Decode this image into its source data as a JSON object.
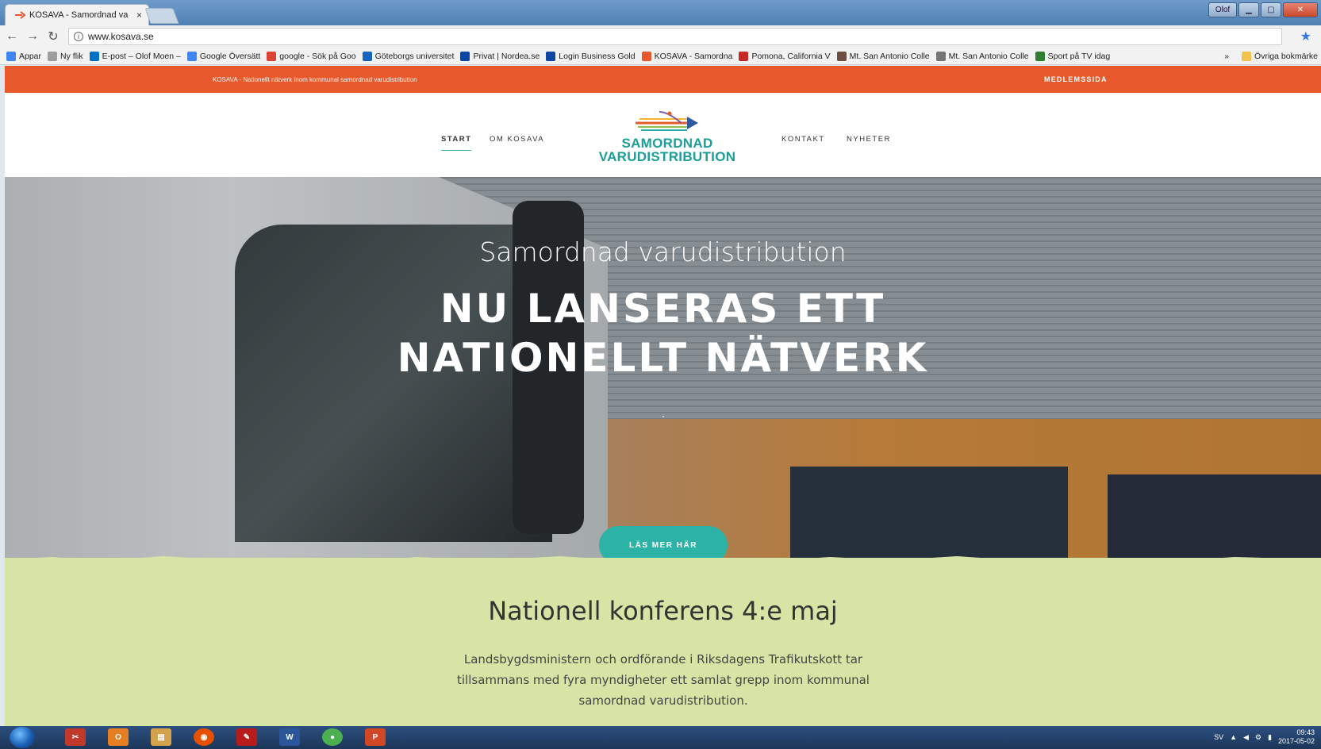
{
  "browser": {
    "tab_title": "KOSAVA - Samordnad va",
    "tab_close": "×",
    "url": "www.kosava.se",
    "window_user": "Olof",
    "bookmarks": [
      {
        "label": "Appar",
        "color": "#4285f4"
      },
      {
        "label": "Ny flik",
        "color": "#9e9e9e"
      },
      {
        "label": "E-post – Olof Moen –",
        "color": "#0072c6"
      },
      {
        "label": "Google Översätt",
        "color": "#4285f4"
      },
      {
        "label": "google - Sök på Goo",
        "color": "#db4437"
      },
      {
        "label": "Göteborgs universitet",
        "color": "#1565c0"
      },
      {
        "label": "Privat | Nordea.se",
        "color": "#0d47a1"
      },
      {
        "label": "Login Business Gold",
        "color": "#0d47a1"
      },
      {
        "label": "KOSAVA - Samordna",
        "color": "#e7582a"
      },
      {
        "label": "Pomona, California V",
        "color": "#c62828"
      },
      {
        "label": "Mt. San Antonio Colle",
        "color": "#6d4c41"
      },
      {
        "label": "Mt. San Antonio Colle",
        "color": "#757575"
      },
      {
        "label": "Sport på TV idag",
        "color": "#2e7d32"
      }
    ],
    "more": "»",
    "other_bookmarks": "Övriga bokmärke"
  },
  "site": {
    "topbar": {
      "tagline": "KOSAVA - Nationellt nätverk inom kommunal samordnad varudistribution",
      "member_link": "MEDLEMSSIDA"
    },
    "nav": {
      "start": "START",
      "om": "OM KOSAVA",
      "kontakt": "KONTAKT",
      "nyheter": "NYHETER"
    },
    "logo": {
      "line1": "SAMORDNAD",
      "line2": "VARUDISTRIBUTION"
    },
    "hero": {
      "subtitle": "Samordnad varudistribution",
      "title_line1": "NU LANSERAS ETT",
      "title_line2": "NATIONELLT NÄTVERK",
      "dot": ".",
      "cta": "LÄS MER HÄR"
    },
    "section": {
      "heading": "Nationell konferens 4:e maj",
      "body": "Landsbygdsministern och ordförande i Riksdagens Trafikutskott tar tillsammans med fyra myndigheter ett samlat grepp inom kommunal samordnad varudistribution."
    }
  },
  "taskbar": {
    "language": "SV",
    "time": "09:43",
    "date": "2017-05-02"
  },
  "colors": {
    "brand_orange": "#e7582a",
    "teal": "#2cb3a6",
    "section_green": "#d6e4a5"
  }
}
